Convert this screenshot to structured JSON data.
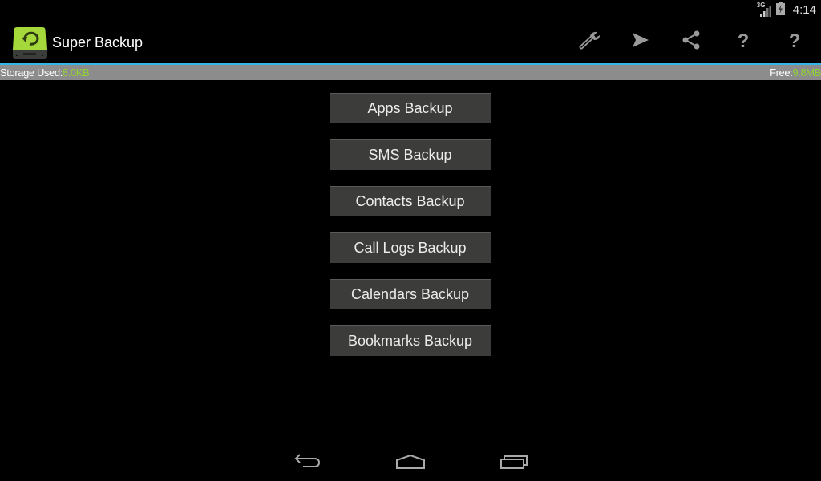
{
  "status_bar": {
    "network_label": "3G",
    "time": "4:14",
    "icons": [
      "signal-3g-icon",
      "battery-charging-icon"
    ]
  },
  "action_bar": {
    "app_title": "Super Backup",
    "app_icon": "super-backup-logo",
    "actions": [
      {
        "name": "settings",
        "icon": "wrench-icon"
      },
      {
        "name": "send",
        "icon": "send-icon"
      },
      {
        "name": "share",
        "icon": "share-icon"
      },
      {
        "name": "help",
        "icon": "question-icon",
        "glyph": "?"
      },
      {
        "name": "about",
        "icon": "question-icon",
        "glyph": "?"
      }
    ]
  },
  "storage": {
    "used_label": "Storage Used:",
    "used_value": "8.0KB",
    "free_label": "Free:",
    "free_value": "9.8MB",
    "accent_color": "#8fd233"
  },
  "backup_buttons": [
    {
      "label": "Apps Backup"
    },
    {
      "label": "SMS Backup"
    },
    {
      "label": "Contacts Backup"
    },
    {
      "label": "Call Logs Backup"
    },
    {
      "label": "Calendars Backup"
    },
    {
      "label": "Bookmarks Backup"
    }
  ],
  "nav_bar": {
    "buttons": [
      "back-icon",
      "home-icon",
      "recent-apps-icon"
    ]
  },
  "colors": {
    "accent_blue": "#33b5e5",
    "storage_bar_bg": "#8c8c8c",
    "button_bg": "#3c3d3a"
  }
}
